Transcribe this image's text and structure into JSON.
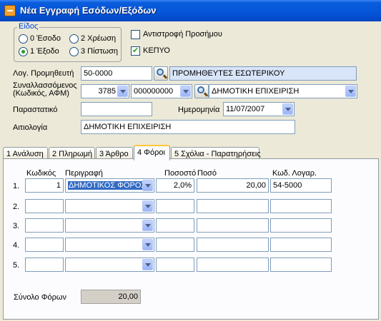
{
  "window": {
    "title": "Νέα Εγγραφή Εσόδων/Εξόδων",
    "icon": "form-icon"
  },
  "type_group": {
    "legend": "Είδος",
    "options": [
      {
        "label": "0 Έσοδο",
        "checked": false
      },
      {
        "label": "2 Χρέωση",
        "checked": false
      },
      {
        "label": "1 Έξοδο",
        "checked": true
      },
      {
        "label": "3 Πίστωση",
        "checked": false
      }
    ]
  },
  "checks": {
    "reverse_sign": {
      "label": "Αντιστροφή Προσήμου",
      "checked": false
    },
    "kepyo": {
      "label": "ΚΕΠΥΟ",
      "checked": true
    }
  },
  "form": {
    "supplier_label": "Λογ. Προμηθευτή",
    "supplier_code": "50-0000",
    "supplier_name": "ΠΡΟΜΗΘΕΥΤΕΣ ΕΣΩΤΕΡΙΚΟΥ",
    "party_label_1": "Συναλλασσόμενος",
    "party_label_2": "(Κωδικός, ΑΦΜ)",
    "party_code": "3785",
    "party_afm": "000000000",
    "party_name": "ΔΗΜΟΤΙΚΗ ΕΠΙΧΕΙΡΙΣΗ",
    "document_label": "Παραστατικό",
    "document_value": "",
    "date_label": "Ημερομηνία",
    "date_value": "11/07/2007",
    "reason_label": "Αιτιολογία",
    "reason_value": "ΔΗΜΟΤΙΚΗ ΕΠΙΧΕΙΡΙΣΗ"
  },
  "tabs": [
    "1 Ανάλυση",
    "2 Πληρωμή",
    "3 Άρθρο",
    "4 Φόροι",
    "5 Σχόλια - Παρατηρήσεις"
  ],
  "active_tab": "4 Φόροι",
  "taxes": {
    "headers": {
      "code": "Κωδικός",
      "description": "Περιγραφή",
      "percent": "Ποσοστό",
      "amount": "Ποσό",
      "account": "Κωδ. Λογαρ."
    },
    "rows": [
      {
        "num": "1.",
        "code": "1",
        "description": "ΔΗΜΟΤΙΚΟΣ ΦΟΡΟΣ",
        "percent": "2,0%",
        "amount": "20,00",
        "account": "54-5000"
      },
      {
        "num": "2.",
        "code": "",
        "description": "",
        "percent": "",
        "amount": "",
        "account": ""
      },
      {
        "num": "3.",
        "code": "",
        "description": "",
        "percent": "",
        "amount": "",
        "account": ""
      },
      {
        "num": "4.",
        "code": "",
        "description": "",
        "percent": "",
        "amount": "",
        "account": ""
      },
      {
        "num": "5.",
        "code": "",
        "description": "",
        "percent": "",
        "amount": "",
        "account": ""
      }
    ],
    "total_label": "Σύνολο Φόρων",
    "total_value": "20,00"
  }
}
